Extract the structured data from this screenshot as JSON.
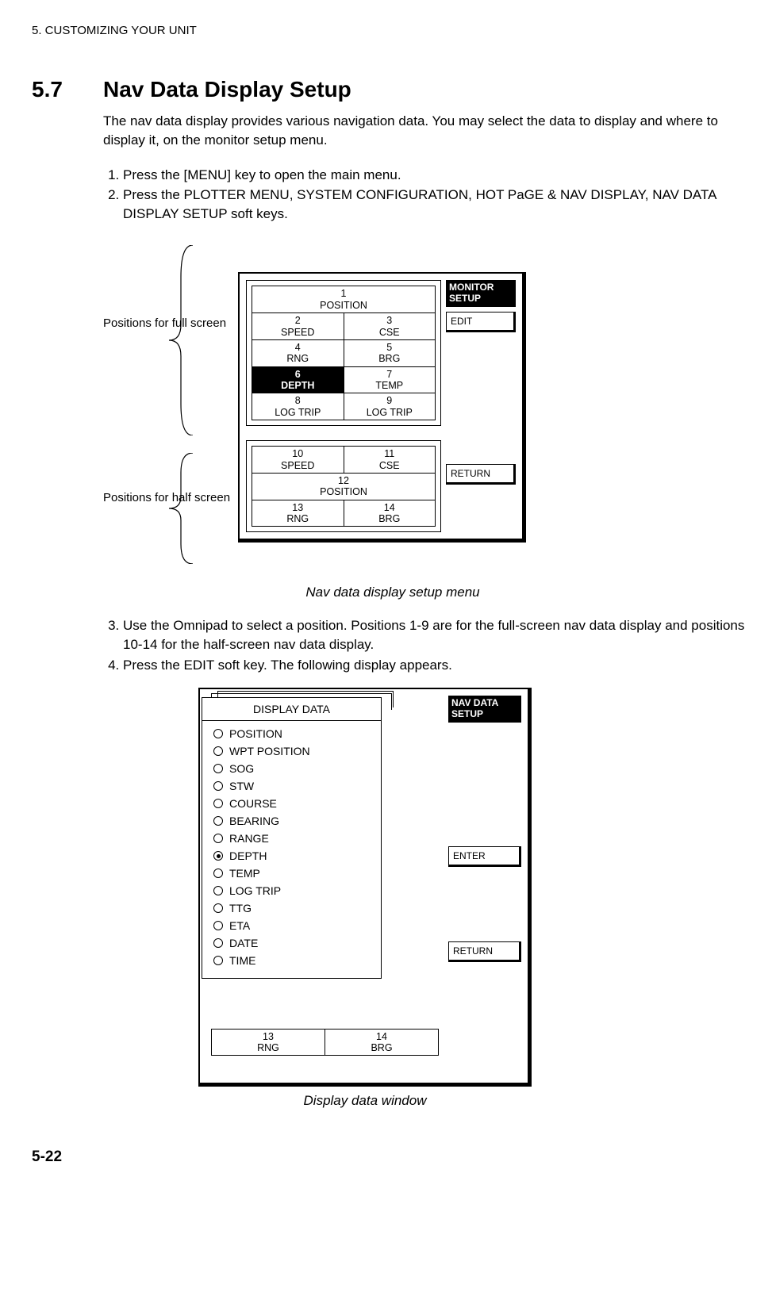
{
  "header": "5. CUSTOMIZING YOUR UNIT",
  "section_number": "5.7",
  "section_title": "Nav Data Display Setup",
  "intro": "The nav data display provides various navigation data. You may select the data to display and where to display it, on the monitor setup menu.",
  "steps1": [
    "Press the [MENU] key to open the main menu.",
    "Press the PLOTTER MENU, SYSTEM CONFIGURATION, HOT PaGE & NAV DISPLAY, NAV DATA DISPLAY SETUP soft keys."
  ],
  "annot_full": "Positions for full screen",
  "annot_half": "Positions for half screen",
  "fig1": {
    "side_title": "MONITOR SETUP",
    "btn_edit": "EDIT",
    "btn_return": "RETURN",
    "top": {
      "c1": {
        "n": "1",
        "l": "POSITION"
      },
      "c2": {
        "n": "2",
        "l": "SPEED"
      },
      "c3": {
        "n": "3",
        "l": "CSE"
      },
      "c4": {
        "n": "4",
        "l": "RNG"
      },
      "c5": {
        "n": "5",
        "l": "BRG"
      },
      "c6": {
        "n": "6",
        "l": "DEPTH"
      },
      "c7": {
        "n": "7",
        "l": "TEMP"
      },
      "c8": {
        "n": "8",
        "l": "LOG TRIP"
      },
      "c9": {
        "n": "9",
        "l": "LOG TRIP"
      }
    },
    "bot": {
      "c10": {
        "n": "10",
        "l": "SPEED"
      },
      "c11": {
        "n": "11",
        "l": "CSE"
      },
      "c12": {
        "n": "12",
        "l": "POSITION"
      },
      "c13": {
        "n": "13",
        "l": "RNG"
      },
      "c14": {
        "n": "14",
        "l": "BRG"
      }
    }
  },
  "fig1_caption": "Nav data display setup menu",
  "steps2": [
    "Use the Omnipad to select a position. Positions 1-9 are for the full-screen nav data display and positions 10-14 for the half-screen nav data display.",
    "Press the EDIT soft key. The following display appears."
  ],
  "fig2": {
    "side_title": "NAV DATA SETUP",
    "btn_enter": "ENTER",
    "btn_return": "RETURN",
    "popup_title": "DISPLAY DATA",
    "options": [
      {
        "label": "POSITION",
        "sel": false
      },
      {
        "label": "WPT POSITION",
        "sel": false
      },
      {
        "label": "SOG",
        "sel": false
      },
      {
        "label": "STW",
        "sel": false
      },
      {
        "label": "COURSE",
        "sel": false
      },
      {
        "label": "BEARING",
        "sel": false
      },
      {
        "label": "RANGE",
        "sel": false
      },
      {
        "label": "DEPTH",
        "sel": true
      },
      {
        "label": "TEMP",
        "sel": false
      },
      {
        "label": "LOG TRIP",
        "sel": false
      },
      {
        "label": "TTG",
        "sel": false
      },
      {
        "label": "ETA",
        "sel": false
      },
      {
        "label": "DATE",
        "sel": false
      },
      {
        "label": "TIME",
        "sel": false
      }
    ],
    "peek_left_n": "13",
    "peek_left_l": "RNG",
    "peek_right_n": "14",
    "peek_right_l": "BRG"
  },
  "fig2_caption": "Display data window",
  "page_num": "5-22"
}
